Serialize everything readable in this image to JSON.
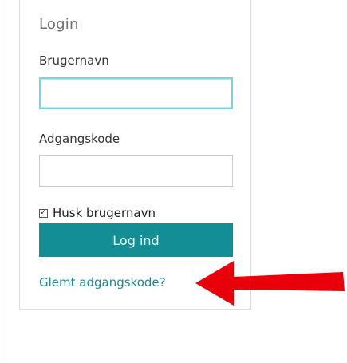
{
  "login": {
    "title": "Login",
    "username_label": "Brugernavn",
    "username_value": "",
    "password_label": "Adgangskode",
    "password_value": "",
    "remember_label": "Husk brugernavn",
    "remember_checked": true,
    "submit_label": "Log ind",
    "forgot_label": "Glemt adgangskode?"
  },
  "annotation": {
    "arrow_color": "#e8000b",
    "arrow_icon": "arrow-left-icon"
  },
  "colors": {
    "accent": "#138e95",
    "focus_border": "#78d4df",
    "link": "#1a8a93"
  }
}
